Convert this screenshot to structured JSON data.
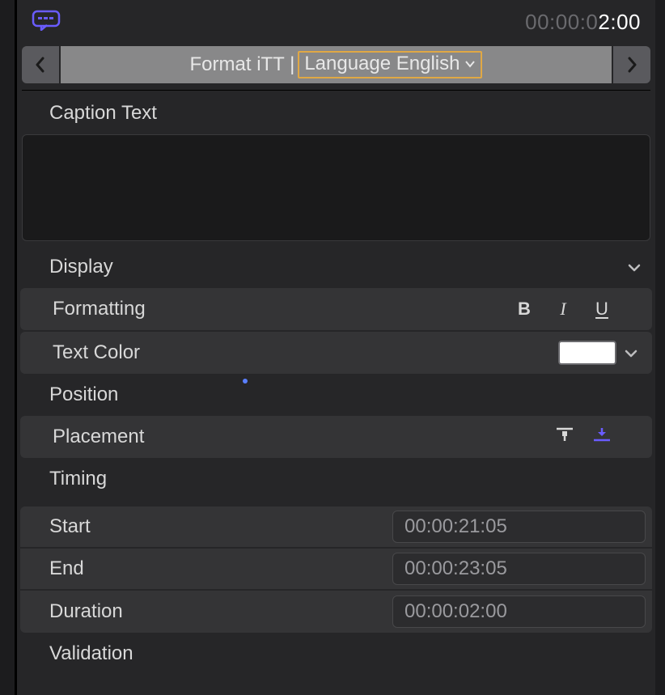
{
  "header": {
    "timecode_dim": "00:00:0",
    "timecode_bright": "2:00"
  },
  "nav": {
    "format_prefix": "Format iTT | ",
    "language_label": "Language English"
  },
  "caption": {
    "label": "Caption Text",
    "value": ""
  },
  "display": {
    "label": "Display"
  },
  "formatting": {
    "label": "Formatting",
    "bold": "B",
    "italic": "I",
    "underline": "U"
  },
  "text_color": {
    "label": "Text Color",
    "value": "#ffffff"
  },
  "position": {
    "label": "Position"
  },
  "placement": {
    "label": "Placement"
  },
  "timing": {
    "label": "Timing",
    "start_label": "Start",
    "start_value": "00:00:21:05",
    "end_label": "End",
    "end_value": "00:00:23:05",
    "duration_label": "Duration",
    "duration_value": "00:00:02:00"
  },
  "validation": {
    "label": "Validation"
  }
}
